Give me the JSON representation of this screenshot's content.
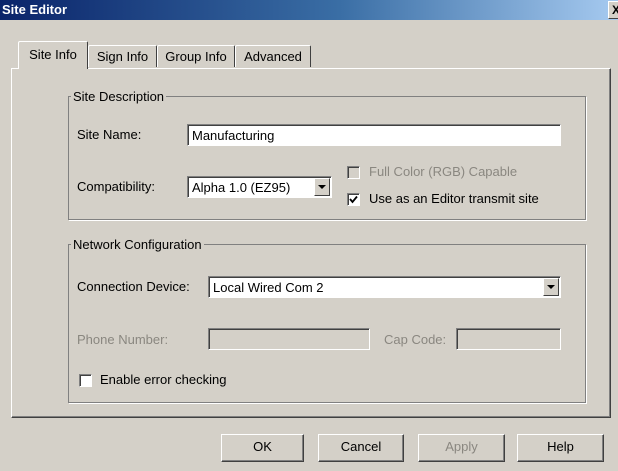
{
  "window": {
    "title": "Site Editor",
    "close_glyph": "X"
  },
  "tabs": [
    {
      "label": "Site Info",
      "active": true
    },
    {
      "label": "Sign Info",
      "active": false
    },
    {
      "label": "Group Info",
      "active": false
    },
    {
      "label": "Advanced",
      "active": false
    }
  ],
  "site_description": {
    "legend": "Site Description",
    "site_name_label": "Site Name:",
    "site_name_value": "Manufacturing",
    "compatibility_label": "Compatibility:",
    "compatibility_value": "Alpha 1.0 (EZ95)",
    "full_color_label": "Full Color (RGB) Capable",
    "full_color_checked": false,
    "full_color_enabled": false,
    "editor_transmit_label": "Use as an Editor transmit site",
    "editor_transmit_checked": true
  },
  "network_configuration": {
    "legend": "Network Configuration",
    "connection_device_label": "Connection Device:",
    "connection_device_value": "Local Wired Com 2",
    "phone_number_label": "Phone Number:",
    "phone_number_value": "",
    "cap_code_label": "Cap Code:",
    "cap_code_value": "",
    "error_checking_label": "Enable error checking",
    "error_checking_checked": false
  },
  "buttons": {
    "ok": "OK",
    "cancel": "Cancel",
    "apply": "Apply",
    "help": "Help"
  },
  "icons": {
    "dropdown": "dropdown-arrow-icon",
    "check": "checkmark-icon",
    "close": "close-icon"
  },
  "colors": {
    "title_bar_start": "#0a246a",
    "title_bar_end": "#a6caf0",
    "face": "#d4d0c8",
    "disabled_text": "#8a8780"
  }
}
